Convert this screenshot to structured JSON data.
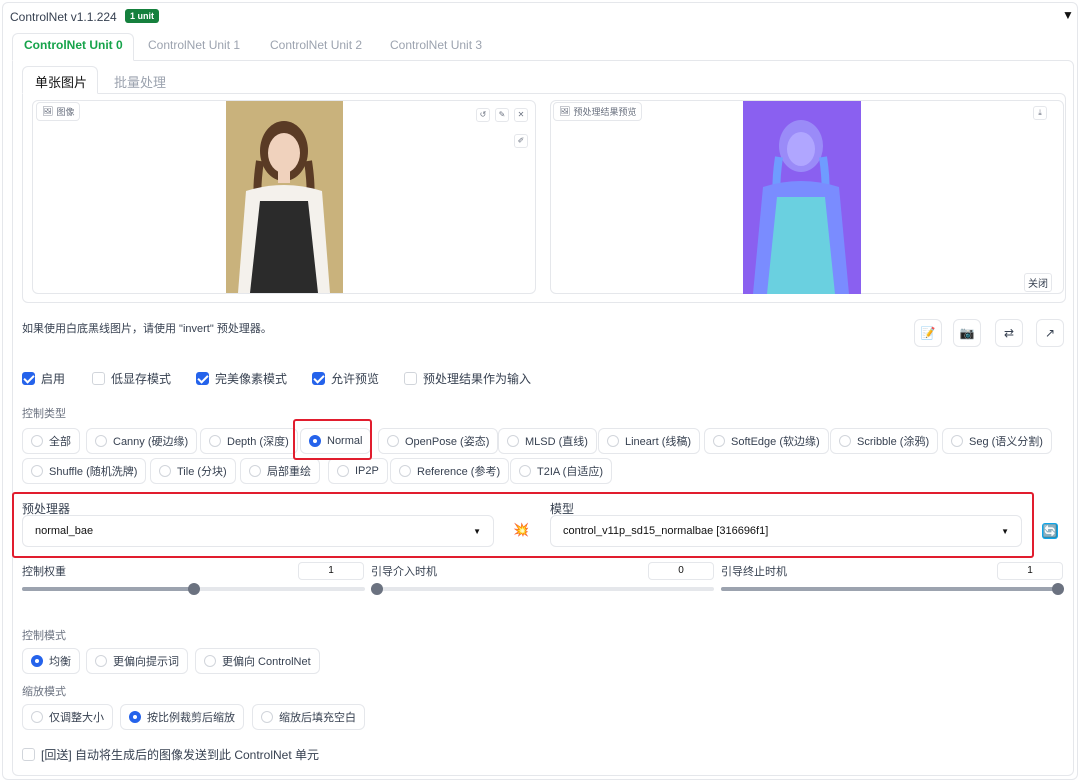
{
  "header": {
    "title": "ControlNet v1.1.224",
    "badge": "1 unit",
    "collapse_icon": "▼"
  },
  "unit_tabs": [
    "ControlNet Unit 0",
    "ControlNet Unit 1",
    "ControlNet Unit 2",
    "ControlNet Unit 3"
  ],
  "image_tabs": [
    "单张图片",
    "批量处理"
  ],
  "input_image": {
    "label": "图像",
    "buttons": [
      "↺",
      "✎",
      "✕",
      "✐"
    ]
  },
  "preview_image": {
    "label": "预处理结果预览",
    "download": "⤓",
    "close": "关闭"
  },
  "hint": "如果使用白底黑线图片，请使用 \"invert\" 预处理器。",
  "tool_buttons": [
    "📝",
    "📷",
    "⇄",
    "↗"
  ],
  "checkboxes": [
    {
      "label": "启用",
      "checked": true
    },
    {
      "label": "低显存模式",
      "checked": false
    },
    {
      "label": "完美像素模式",
      "checked": true
    },
    {
      "label": "允许预览",
      "checked": true
    },
    {
      "label": "预处理结果作为输入",
      "checked": false
    }
  ],
  "control_type": {
    "label": "控制类型",
    "options": [
      "全部",
      "Canny (硬边缘)",
      "Depth (深度)",
      "Normal",
      "OpenPose (姿态)",
      "MLSD (直线)",
      "Lineart (线稿)",
      "SoftEdge (软边缘)",
      "Scribble (涂鸦)",
      "Seg (语义分割)",
      "Shuffle (随机洗牌)",
      "Tile (分块)",
      "局部重绘",
      "IP2P",
      "Reference (参考)",
      "T2IA (自适应)"
    ],
    "selected": "Normal"
  },
  "preprocessor": {
    "label": "预处理器",
    "value": "normal_bae",
    "run_icon": "💥"
  },
  "model": {
    "label": "模型",
    "value": "control_v11p_sd15_normalbae [316696f1]",
    "refresh_icon": "🔄"
  },
  "sliders": [
    {
      "label": "控制权重",
      "value": "1",
      "fraction": 0.5
    },
    {
      "label": "引导介入时机",
      "value": "0",
      "fraction": 0.0
    },
    {
      "label": "引导终止时机",
      "value": "1",
      "fraction": 1.0
    }
  ],
  "control_mode": {
    "label": "控制模式",
    "options": [
      "均衡",
      "更偏向提示词",
      "更偏向 ControlNet"
    ],
    "selected": "均衡"
  },
  "resize_mode": {
    "label": "缩放模式",
    "options": [
      "仅调整大小",
      "按比例裁剪后缩放",
      "缩放后填充空白"
    ],
    "selected": "按比例裁剪后缩放"
  },
  "loopback": {
    "label": "[回送] 自动将生成后的图像发送到此 ControlNet 单元",
    "checked": false
  }
}
